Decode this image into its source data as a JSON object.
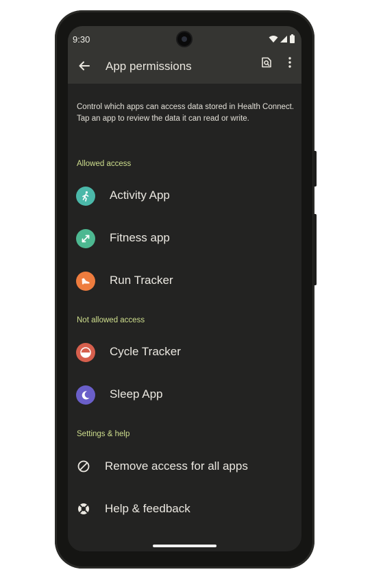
{
  "status_bar": {
    "time": "9:30"
  },
  "header": {
    "title": "App permissions",
    "icons": [
      "back-arrow-icon",
      "app-search-icon",
      "more-vert-icon"
    ]
  },
  "description": "Control which apps can access data stored in Health Connect. Tap an app to review the data it can read or write.",
  "sections": {
    "allowed": "Allowed access",
    "not_allowed": "Not allowed access",
    "settings": "Settings & help"
  },
  "allowed_apps": [
    {
      "label": "Activity App",
      "icon": "running-person-icon",
      "color": "#4bb8a9"
    },
    {
      "label": "Fitness app",
      "icon": "expand-arrows-icon",
      "color": "#4db891"
    },
    {
      "label": "Run Tracker",
      "icon": "sneaker-icon",
      "color": "#ee7c3e"
    }
  ],
  "not_allowed_apps": [
    {
      "label": "Cycle Tracker",
      "icon": "half-circle-icon",
      "color": "#d65f4d"
    },
    {
      "label": "Sleep App",
      "icon": "moon-icon",
      "color": "#6a5fc9"
    }
  ],
  "settings": [
    {
      "label": "Remove access for all apps",
      "icon": "block-icon"
    },
    {
      "label": "Help & feedback",
      "icon": "help-lifebuoy-icon"
    }
  ],
  "colors": {
    "background": "#232322",
    "app_bar": "#353532",
    "section_header": "#cfdf8e",
    "text": "#ebe8e1"
  }
}
